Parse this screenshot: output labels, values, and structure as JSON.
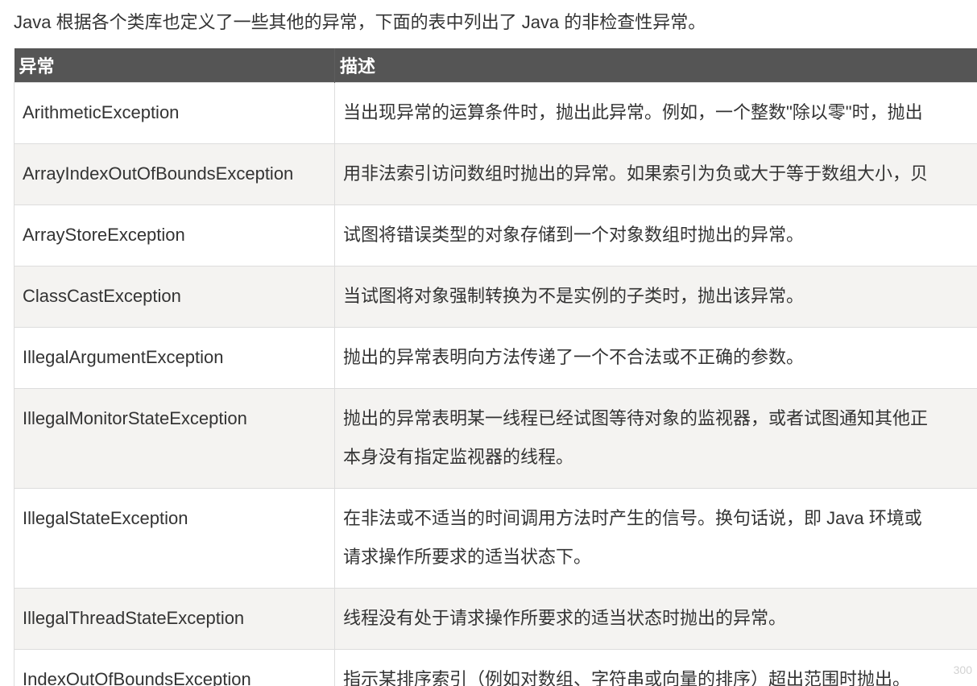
{
  "intro": "Java 根据各个类库也定义了一些其他的异常，下面的表中列出了 Java 的非检查性异常。",
  "table": {
    "headers": [
      "异常",
      "描述"
    ],
    "rows": [
      {
        "name": "ArithmeticException",
        "desc": "当出现异常的运算条件时，抛出此异常。例如，一个整数\"除以零\"时，抛出"
      },
      {
        "name": "ArrayIndexOutOfBoundsException",
        "desc": "用非法索引访问数组时抛出的异常。如果索引为负或大于等于数组大小，贝"
      },
      {
        "name": "ArrayStoreException",
        "desc": "试图将错误类型的对象存储到一个对象数组时抛出的异常。"
      },
      {
        "name": "ClassCastException",
        "desc": "当试图将对象强制转换为不是实例的子类时，抛出该异常。"
      },
      {
        "name": "IllegalArgumentException",
        "desc": "抛出的异常表明向方法传递了一个不合法或不正确的参数。"
      },
      {
        "name": "IllegalMonitorStateException",
        "desc_lines": [
          "抛出的异常表明某一线程已经试图等待对象的监视器，或者试图通知其他正",
          "本身没有指定监视器的线程。"
        ]
      },
      {
        "name": "IllegalStateException",
        "desc_lines": [
          "在非法或不适当的时间调用方法时产生的信号。换句话说，即 Java 环境或",
          "请求操作所要求的适当状态下。"
        ]
      },
      {
        "name": "IllegalThreadStateException",
        "desc": "线程没有处于请求操作所要求的适当状态时抛出的异常。"
      },
      {
        "name": "IndexOutOfBoundsException",
        "desc": "指示某排序索引（例如对数组、字符串或向量的排序）超出范围时抛出。"
      }
    ]
  },
  "watermark": "300"
}
